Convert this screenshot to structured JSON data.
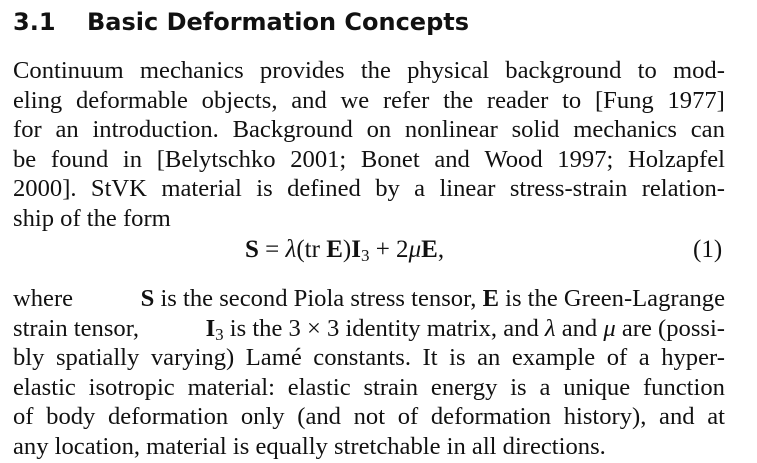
{
  "section": {
    "number": "3.1",
    "title": "Basic Deformation Concepts"
  },
  "paragraph1": {
    "lines": [
      [
        "Continuum",
        "mechanics",
        "provides",
        "the",
        "physical",
        "background",
        "to",
        "mod-"
      ],
      [
        "eling",
        "deformable",
        "objects,",
        "and",
        "we",
        "refer",
        "the",
        "reader",
        "to",
        "[Fung",
        "1977]"
      ],
      [
        "for",
        "an",
        "introduction.",
        "Background",
        "on",
        "nonlinear",
        "solid",
        "mechanics",
        "can"
      ],
      [
        "be",
        "found",
        "in",
        "[Belytschko",
        "2001;",
        "Bonet",
        "and",
        "Wood",
        "1997;",
        "Holzapfel"
      ],
      [
        "2000].",
        "StVK",
        "material",
        "is",
        "defined",
        "by",
        "a",
        "linear",
        "stress-strain",
        "relation-"
      ]
    ],
    "last_line": "ship of the form"
  },
  "equation": {
    "S": "S",
    "eq": " = ",
    "lambda": "λ",
    "open": "(tr ",
    "E1": "E",
    "close": ")",
    "I": "I",
    "sub3": "3",
    "plus": " + 2",
    "mu": "μ",
    "E2": "E",
    "comma": ",",
    "number": "(1)"
  },
  "paragraph2": {
    "line1": {
      "t1": "where",
      "t2": " is the second Piola stress tensor, ",
      "t3": " is the Green-Lagrange",
      "S": "S",
      "E": "E"
    },
    "line2": {
      "t1": "strain tensor, ",
      "I": "I",
      "sub3": "3",
      "t2": " is the 3 × 3 identity matrix, and ",
      "lambda": "λ",
      "t3": " and ",
      "mu": "μ",
      "t4": " are (possi-"
    },
    "lines": [
      [
        "bly",
        "spatially",
        "varying)",
        "Lamé",
        "constants.",
        "It",
        "is",
        "an",
        "example",
        "of",
        "a",
        "hyper-"
      ],
      [
        "elastic",
        "isotropic",
        "material:",
        "elastic",
        "strain",
        "energy",
        "is",
        "a",
        "unique",
        "function"
      ],
      [
        "of",
        "body",
        "deformation",
        "only",
        "(and",
        "not",
        "of",
        "deformation",
        "history),",
        "and",
        "at"
      ]
    ],
    "last_line": "any location, material is equally stretchable in all directions."
  }
}
